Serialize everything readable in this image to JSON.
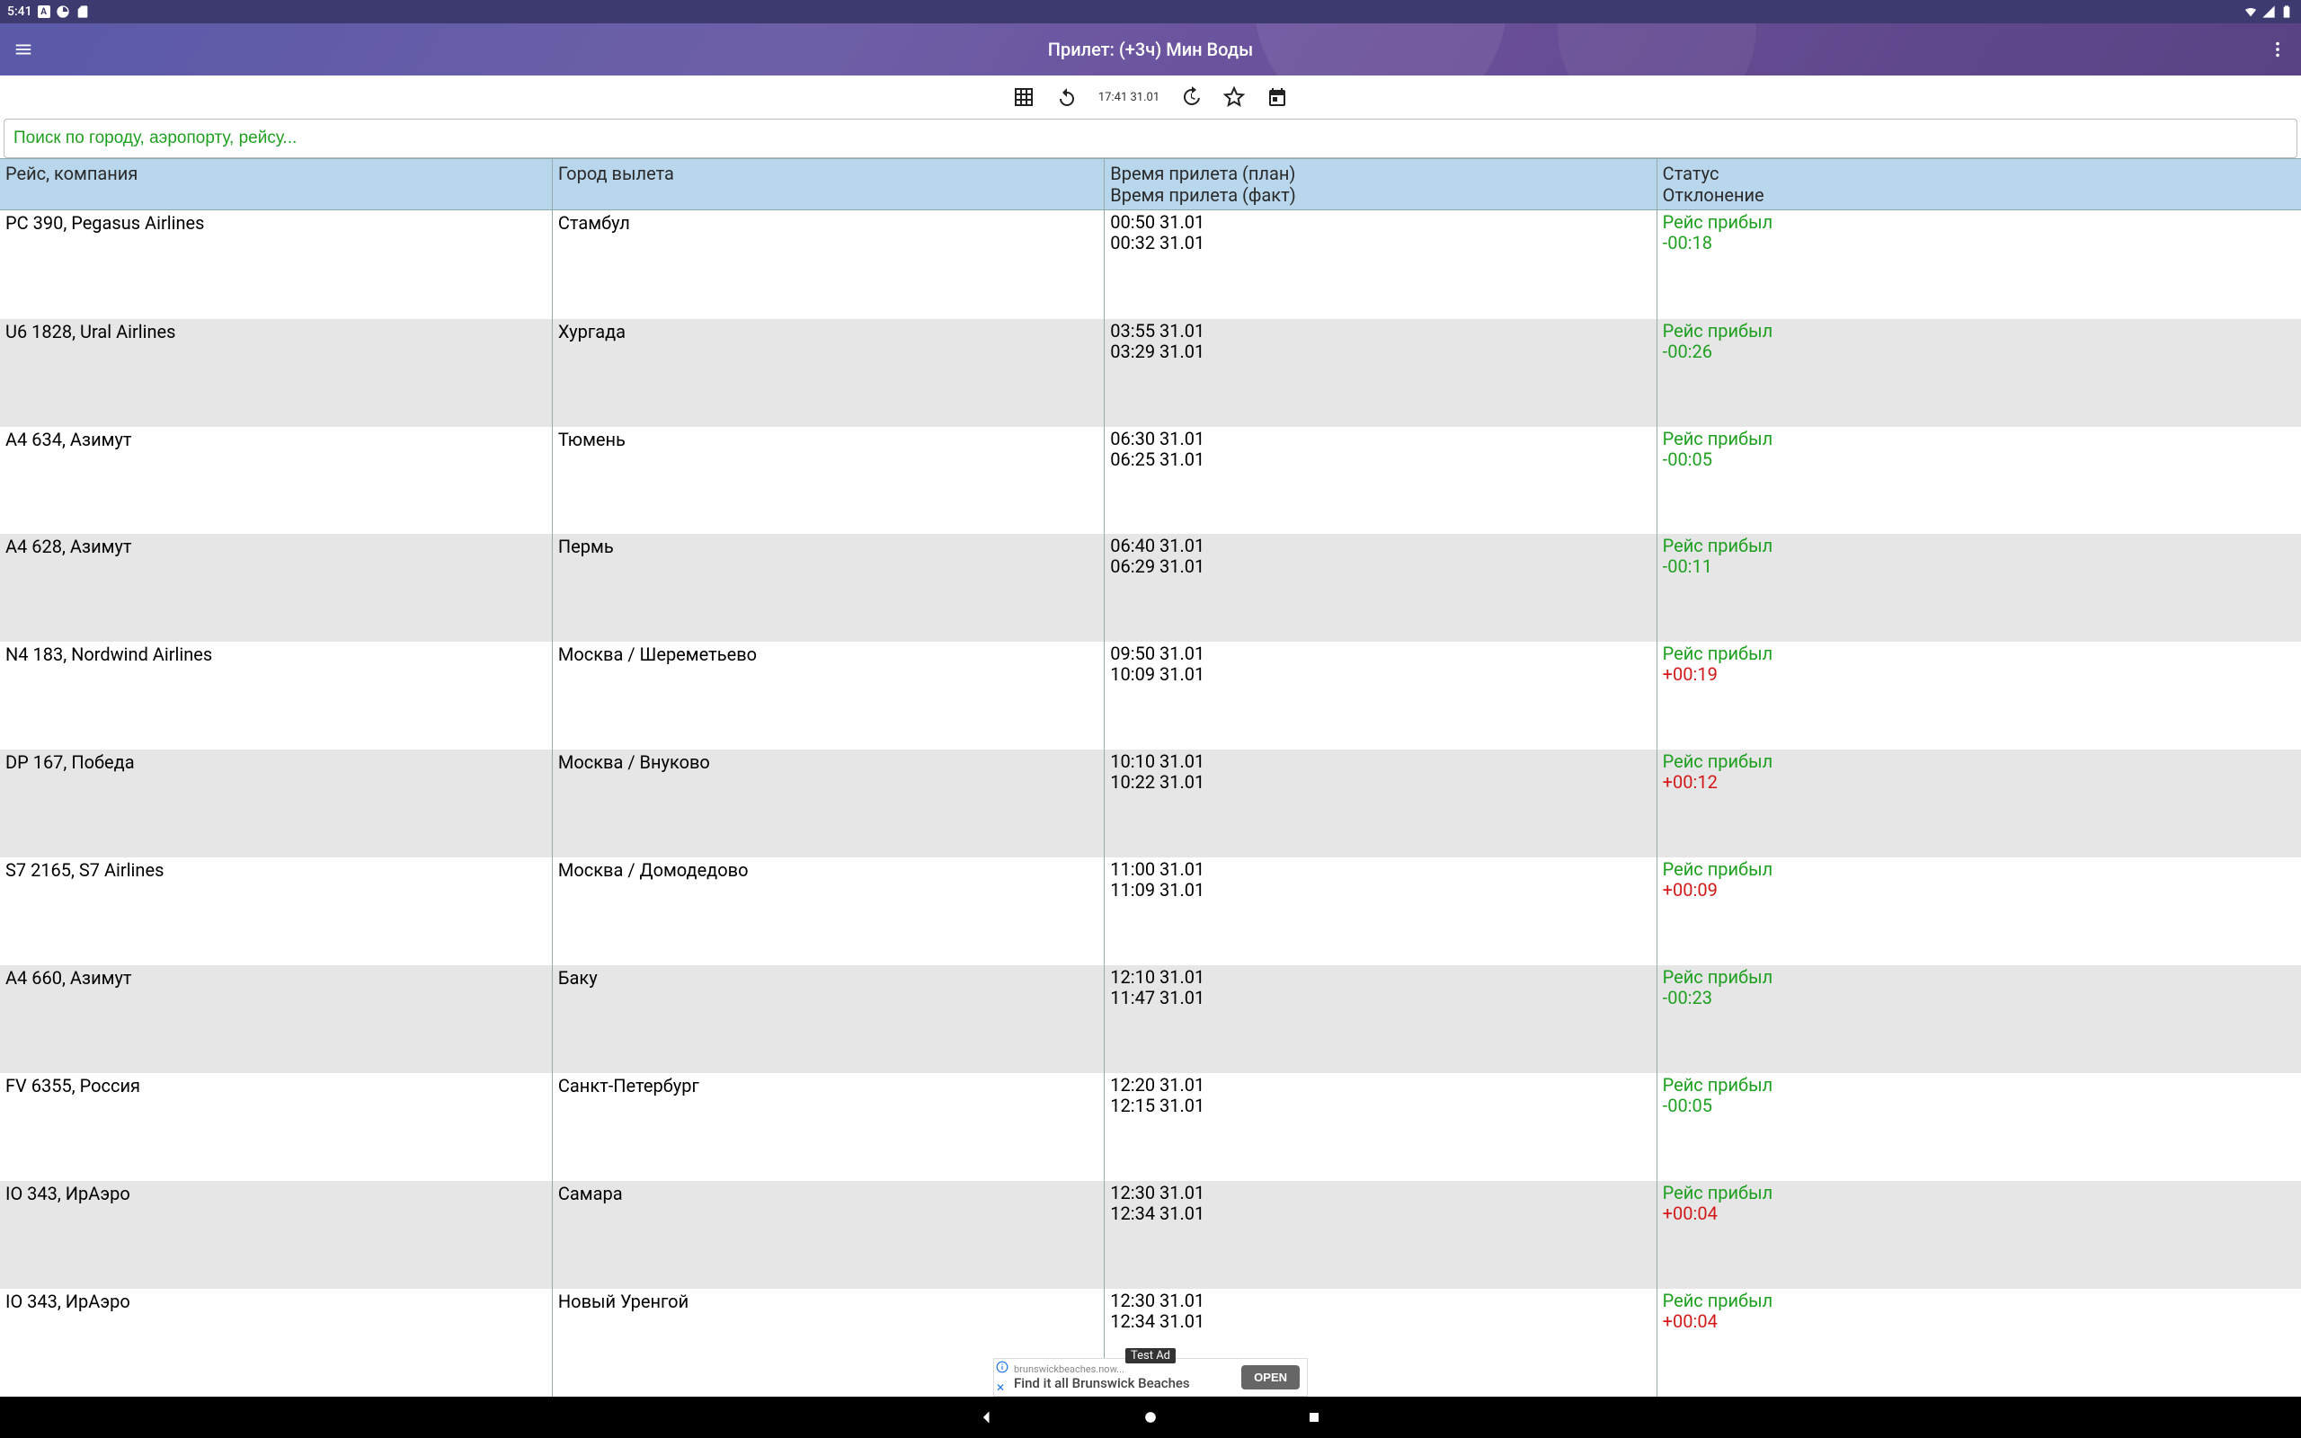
{
  "status_bar": {
    "time": "5:41"
  },
  "app_bar": {
    "title": "Прилет: (+3ч) Мин Воды"
  },
  "toolbar": {
    "timestamp": "17:41 31.01"
  },
  "search": {
    "placeholder": "Поиск по городу, аэропорту, рейсу..."
  },
  "table": {
    "headers": {
      "flight": "Рейс, компания",
      "city": "Город вылета",
      "time_plan": "Время прилета (план)",
      "time_fact": "Время прилета (факт)",
      "status": "Статус",
      "deviation": "Отклонение"
    },
    "rows": [
      {
        "flight": "PC 390, Pegasus Airlines",
        "city": "Стамбул",
        "plan": "00:50 31.01",
        "fact": "00:32 31.01",
        "status": "Рейс прибыл",
        "dev": "-00:18",
        "dev_sign": "neg"
      },
      {
        "flight": "U6 1828, Ural Airlines",
        "city": "Хургада",
        "plan": "03:55 31.01",
        "fact": "03:29 31.01",
        "status": "Рейс прибыл",
        "dev": "-00:26",
        "dev_sign": "neg"
      },
      {
        "flight": "A4 634, Азимут",
        "city": "Тюмень",
        "plan": "06:30 31.01",
        "fact": "06:25 31.01",
        "status": "Рейс прибыл",
        "dev": "-00:05",
        "dev_sign": "neg"
      },
      {
        "flight": "A4 628, Азимут",
        "city": "Пермь",
        "plan": "06:40 31.01",
        "fact": "06:29 31.01",
        "status": "Рейс прибыл",
        "dev": "-00:11",
        "dev_sign": "neg"
      },
      {
        "flight": "N4 183, Nordwind Airlines",
        "city": "Москва / Шереметьево",
        "plan": "09:50 31.01",
        "fact": "10:09 31.01",
        "status": "Рейс прибыл",
        "dev": "+00:19",
        "dev_sign": "pos"
      },
      {
        "flight": "DP 167, Победа",
        "city": "Москва / Внуково",
        "plan": "10:10 31.01",
        "fact": "10:22 31.01",
        "status": "Рейс прибыл",
        "dev": "+00:12",
        "dev_sign": "pos"
      },
      {
        "flight": "S7 2165, S7 Airlines",
        "city": "Москва / Домодедово",
        "plan": "11:00 31.01",
        "fact": "11:09 31.01",
        "status": "Рейс прибыл",
        "dev": "+00:09",
        "dev_sign": "pos"
      },
      {
        "flight": "A4 660, Азимут",
        "city": "Баку",
        "plan": "12:10 31.01",
        "fact": "11:47 31.01",
        "status": "Рейс прибыл",
        "dev": "-00:23",
        "dev_sign": "neg"
      },
      {
        "flight": "FV 6355, Россия",
        "city": "Санкт-Петербург",
        "plan": "12:20 31.01",
        "fact": "12:15 31.01",
        "status": "Рейс прибыл",
        "dev": "-00:05",
        "dev_sign": "neg"
      },
      {
        "flight": "IO 343, ИрАэро",
        "city": "Самара",
        "plan": "12:30 31.01",
        "fact": "12:34 31.01",
        "status": "Рейс прибыл",
        "dev": "+00:04",
        "dev_sign": "pos"
      },
      {
        "flight": "IO 343, ИрАэро",
        "city": "Новый Уренгой",
        "plan": "12:30 31.01",
        "fact": "12:34 31.01",
        "status": "Рейс прибыл",
        "dev": "+00:04",
        "dev_sign": "pos"
      }
    ]
  },
  "ad": {
    "badge": "Test Ad",
    "line1": "brunswickbeaches.now...",
    "line2": "Find it all Brunswick Beaches",
    "button": "OPEN"
  }
}
